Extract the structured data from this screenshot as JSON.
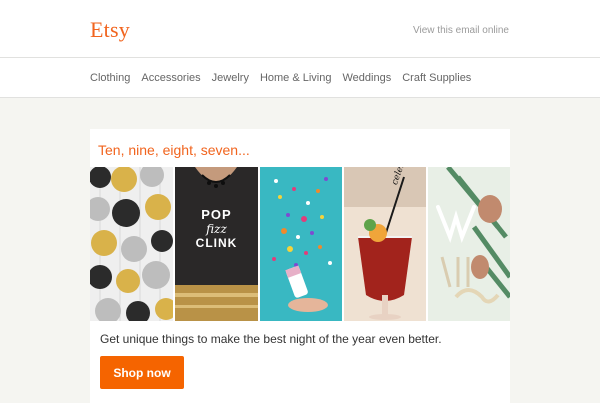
{
  "header": {
    "logo_text": "Etsy",
    "view_online": "View this email online"
  },
  "nav": {
    "items": [
      "Clothing",
      "Accessories",
      "Jewelry",
      "Home & Living",
      "Weddings",
      "Craft Supplies"
    ]
  },
  "promo": {
    "headline": "Ten, nine, eight, seven...",
    "photos": [
      {
        "icon": "paper-circle-garland-image"
      },
      {
        "icon": "pop-fizz-clink-tshirt-image",
        "shirt_text": [
          "POP",
          "fizz",
          "CLINK"
        ]
      },
      {
        "icon": "confetti-popper-image"
      },
      {
        "icon": "cocktail-stirrer-image",
        "stirrer_text": "celebrate"
      },
      {
        "icon": "cake-topper-letters-image"
      }
    ],
    "description": "Get unique things to make the best night of the year even better.",
    "cta_label": "Shop now"
  },
  "colors": {
    "brand": "#f1641e",
    "button": "#f56400",
    "background": "#f5f5f1"
  }
}
